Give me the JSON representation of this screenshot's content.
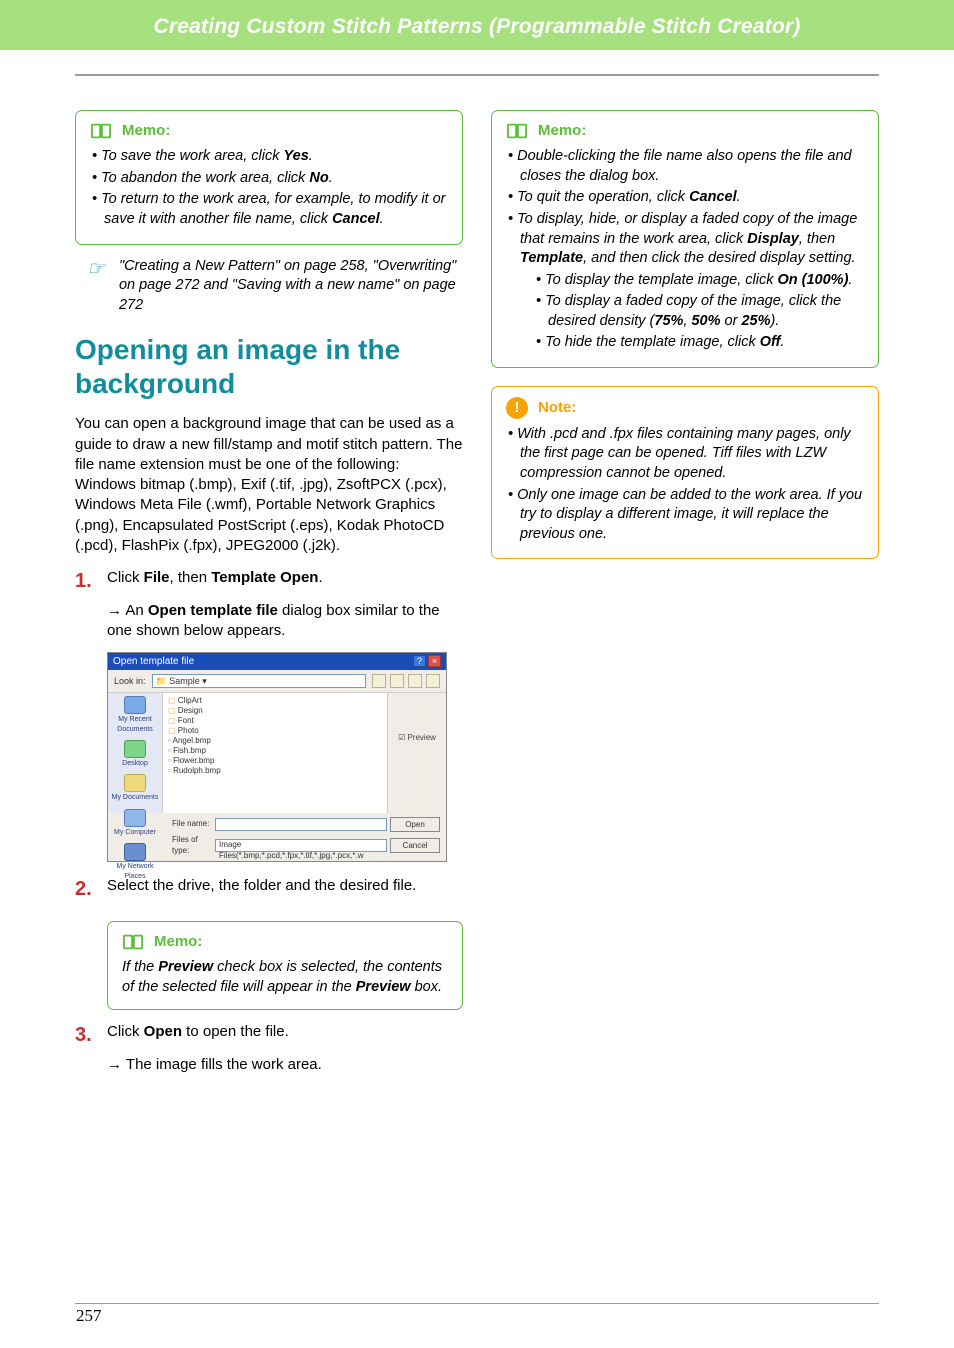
{
  "chapter_title": "Creating Custom Stitch Patterns (Programmable Stitch Creator)",
  "memo_label": "Memo:",
  "note_label": "Note:",
  "memo1": {
    "items_html": [
      "To save the work area, click <span class='b'>Yes</span>.",
      "To abandon the work area, click <span class='b'>No</span>.",
      "To return to the work area, for example, to modify it or save it with another file name, click <span class='b'>Cancel</span>."
    ]
  },
  "ref_text": "\"Creating a New Pattern\" on page 258, \"Overwriting\" on page 272 and \"Saving with a new name\" on page 272",
  "section_title": "Opening an image in the background",
  "intro_para": "You can open a background image that can be used as a guide to draw a new fill/stamp and motif stitch pattern. The file name extension must be one of the following: Windows bitmap (.bmp), Exif (.tif, .jpg), ZsoftPCX (.pcx), Windows Meta File (.wmf), Portable Network Graphics (.png), Encapsulated PostScript (.eps), Kodak PhotoCD (.pcd), FlashPix (.fpx), JPEG2000 (.j2k).",
  "step1_html": "Click <span class='bnorm'>File</span>, then <span class='bnorm'>Template Open</span>.",
  "step1_result_html": "An <span class='bnorm'>Open template file</span> dialog box similar to the one shown below appears.",
  "step2": "Select the drive, the folder and the desired file.",
  "memo2_html": "If the <span class='b'>Preview</span> check box is selected, the contents of the selected file will appear in the <span class='b'>Preview</span> box.",
  "step3_html": "Click <span class='bnorm'>Open</span> to open the file.",
  "step3_result": "The image fills the work area.",
  "memo3": {
    "items_html": [
      "Double-clicking the file name also opens the file and closes the dialog box.",
      "To quit the operation, click <span class='b'>Cancel</span>.",
      "To display, hide, or display a faded copy of the image that remains in the work area, click <span class='b'>Display</span>, then <span class='b'>Template</span>, and then click the desired display setting."
    ],
    "subitems_html": [
      "To display the template image, click <span class='b'>On (100%)</span>.",
      "To display a faded copy of the image, click the desired density (<span class='b'>75%</span>, <span class='b'>50%</span> or <span class='b'>25%</span>).",
      "To hide the template image, click <span class='b'>Off</span>."
    ]
  },
  "note1": {
    "items_html": [
      "With .pcd and .fpx files containing many pages, only the first page can be opened. Tiff files with LZW compression cannot be opened.",
      "Only one image can be added to the work area. If you try to display a different image, it will replace the previous one."
    ]
  },
  "dialog": {
    "title": "Open template file",
    "lookin_label": "Look in:",
    "lookin_value": "Sample",
    "places": [
      "My Recent Documents",
      "Desktop",
      "My Documents",
      "My Computer",
      "My Network Places"
    ],
    "folders": [
      "ClipArt",
      "Design",
      "Font",
      "Photo"
    ],
    "files": [
      "Angel.bmp",
      "Fish.bmp",
      "Flower.bmp",
      "Rudolph.bmp"
    ],
    "preview_label": "Preview",
    "filename_label": "File name:",
    "filetype_label": "Files of type:",
    "filetype_value": "Image Files(*.bmp,*.pcd,*.fpx,*.tif,*.jpg,*.pcx,*.w",
    "open_btn": "Open",
    "cancel_btn": "Cancel"
  },
  "page_number": "257"
}
